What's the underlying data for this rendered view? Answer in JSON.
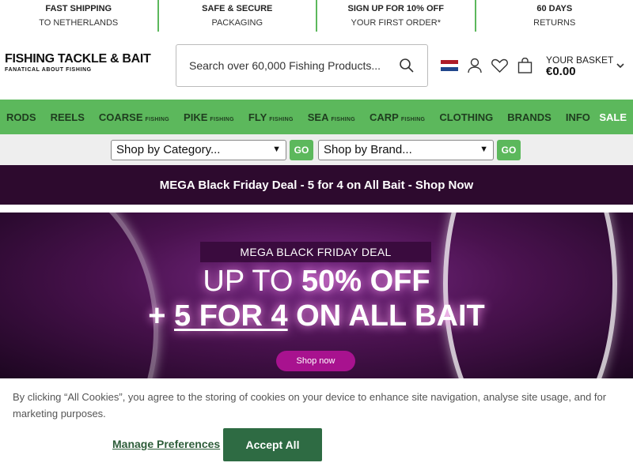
{
  "topbar": [
    {
      "title": "FAST SHIPPING",
      "sub": "TO NETHERLANDS"
    },
    {
      "title": "SAFE & SECURE",
      "sub": "PACKAGING"
    },
    {
      "title": "SIGN UP FOR 10% OFF",
      "sub": "YOUR FIRST ORDER*"
    },
    {
      "title": "60 DAYS",
      "sub": "RETURNS"
    }
  ],
  "logo": {
    "line1": "FISHING TACKLE & BAIT",
    "line2": "FANATICAL ABOUT FISHING"
  },
  "search": {
    "placeholder": "Search over 60,000 Fishing Products..."
  },
  "basket": {
    "title": "YOUR BASKET",
    "amount": "€0.00"
  },
  "nav": {
    "items": [
      {
        "label": "RODS",
        "suffix": ""
      },
      {
        "label": "REELS",
        "suffix": ""
      },
      {
        "label": "COARSE",
        "suffix": "FISHING"
      },
      {
        "label": "PIKE",
        "suffix": "FISHING"
      },
      {
        "label": "FLY",
        "suffix": "FISHING"
      },
      {
        "label": "SEA",
        "suffix": "FISHING"
      },
      {
        "label": "CARP",
        "suffix": "FISHING"
      },
      {
        "label": "CLOTHING",
        "suffix": ""
      },
      {
        "label": "BRANDS",
        "suffix": ""
      },
      {
        "label": "INFO",
        "suffix": ""
      }
    ],
    "sale": "SALE",
    "accent": "#5cb85c"
  },
  "shopbar": {
    "category": "Shop by Category...",
    "brand": "Shop by Brand...",
    "go": "GO"
  },
  "promo": {
    "text": "MEGA Black Friday Deal - 5 for 4 on All Bait - Shop Now"
  },
  "banner": {
    "deal": "MEGA BLACK FRIDAY DEAL",
    "line1_a": "UP TO ",
    "line1_b": "50% OFF",
    "line2_a": "+ ",
    "line2_b": "5 FOR 4",
    "line2_c": " ON ALL BAIT",
    "button": "Shop now"
  },
  "cookie": {
    "text": "By clicking “All Cookies”, you agree to the storing of cookies on your device to enhance site navigation, analyse site usage, and for marketing purposes.",
    "manage": "Manage Preferences",
    "accept": "Accept All"
  },
  "icons": [
    "netherlands-flag-icon",
    "account-icon",
    "heart-icon",
    "basket-icon",
    "search-icon",
    "chevron-down-icon"
  ]
}
